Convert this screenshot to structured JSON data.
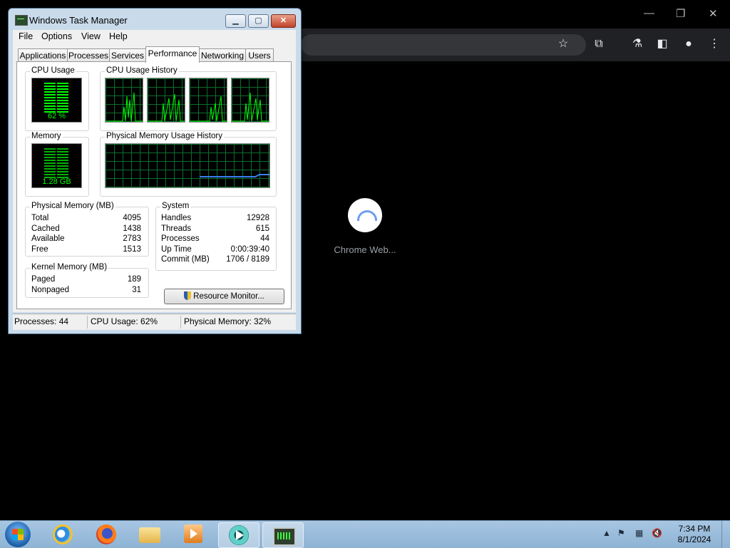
{
  "chrome": {
    "loading_label": "Chrome Web..."
  },
  "task_manager": {
    "title": "Windows Task Manager",
    "window_buttons": {
      "minimize": "▁",
      "maximize": "▢",
      "close": "✕"
    },
    "menu": [
      "File",
      "Options",
      "View",
      "Help"
    ],
    "tabs": [
      "Applications",
      "Processes",
      "Services",
      "Performance",
      "Networking",
      "Users"
    ],
    "active_tab": "Performance",
    "performance": {
      "cpu_usage": {
        "label": "CPU Usage",
        "value": "62 %",
        "percent": 62
      },
      "cpu_history": {
        "label": "CPU Usage History",
        "cores": 4
      },
      "memory": {
        "label": "Memory",
        "value": "1.28 GB"
      },
      "memory_history": {
        "label": "Physical Memory Usage History"
      },
      "physical_memory": {
        "label": "Physical Memory (MB)",
        "rows": [
          {
            "key": "Total",
            "value": "4095"
          },
          {
            "key": "Cached",
            "value": "1438"
          },
          {
            "key": "Available",
            "value": "2783"
          },
          {
            "key": "Free",
            "value": "1513"
          }
        ]
      },
      "system": {
        "label": "System",
        "rows": [
          {
            "key": "Handles",
            "value": "12928"
          },
          {
            "key": "Threads",
            "value": "615"
          },
          {
            "key": "Processes",
            "value": "44"
          },
          {
            "key": "Up Time",
            "value": "0:00:39:40"
          },
          {
            "key": "Commit (MB)",
            "value": "1706 / 8189"
          }
        ]
      },
      "kernel_memory": {
        "label": "Kernel Memory (MB)",
        "rows": [
          {
            "key": "Paged",
            "value": "189"
          },
          {
            "key": "Nonpaged",
            "value": "31"
          }
        ]
      },
      "resource_monitor_button": "Resource Monitor..."
    },
    "status_bar": {
      "processes": "Processes: 44",
      "cpu_usage": "CPU Usage: 62%",
      "physical_memory": "Physical Memory: 32%"
    }
  },
  "taskbar": {
    "apps": [
      "internet-explorer",
      "firefox",
      "windows-explorer",
      "windows-media-player",
      "chrome",
      "task-manager"
    ],
    "clock": {
      "time": "7:34 PM",
      "date": "8/1/2024"
    }
  }
}
